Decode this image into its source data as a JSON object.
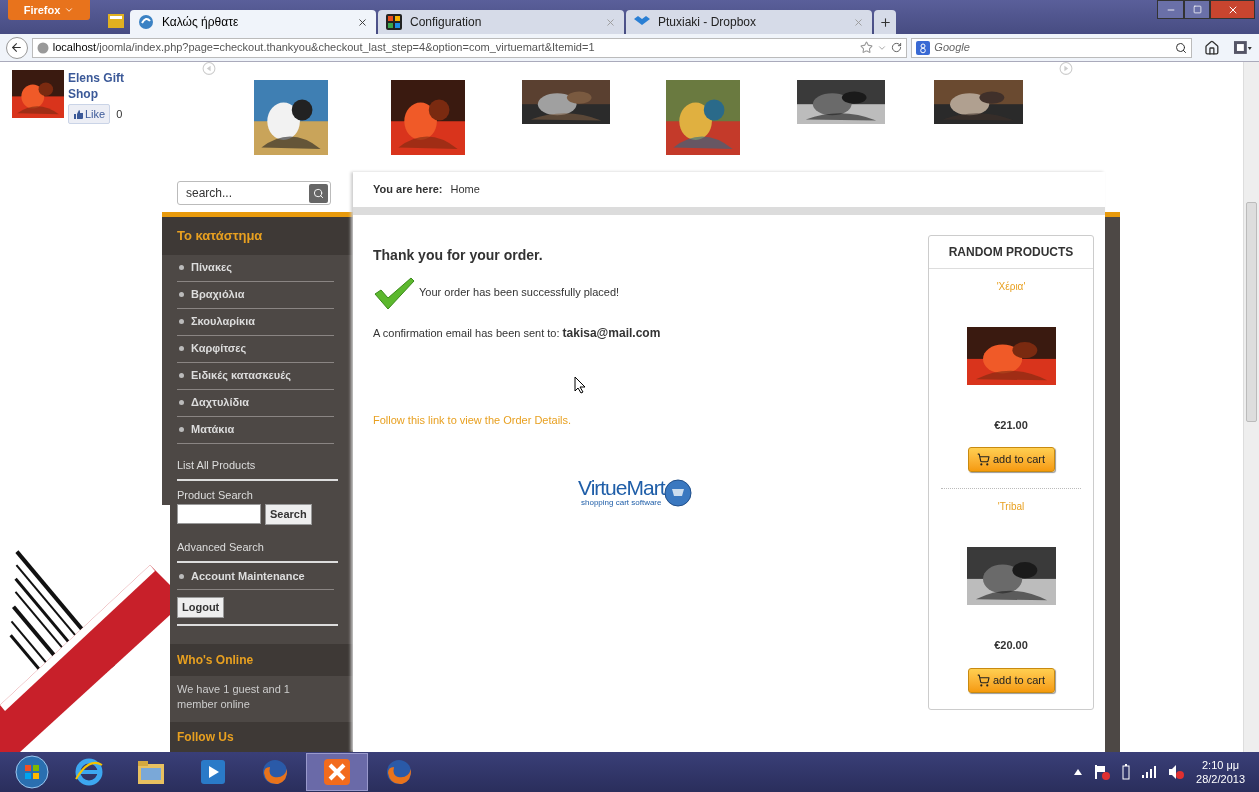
{
  "browser": {
    "menu_button": "Firefox",
    "tabs": [
      {
        "title": "Καλώς ήρθατε",
        "selected": true
      },
      {
        "title": "Configuration",
        "selected": false
      },
      {
        "title": "Ptuxiaki - Dropbox",
        "selected": false
      }
    ],
    "address": "**localhost**/joomla/index.php?page=checkout.thankyou&checkout_last_step=4&option=com_virtuemart&Itemid=1",
    "search_placeholder": "Google"
  },
  "facebook": {
    "page_name": "Elens Gift Shop",
    "like": "Like",
    "count": "0"
  },
  "site_search": {
    "placeholder": "search..."
  },
  "breadcrumb": {
    "label": "You are here:",
    "current": "Home"
  },
  "sidebar": {
    "title": "Το κατάστημα",
    "categories": [
      "Πίνακες",
      "Βραχιόλια",
      "Σκουλαρίκια",
      "Καρφίτσες",
      "Ειδικές κατασκευές",
      "Δαχτυλίδια",
      "Ματάκια"
    ],
    "list_all": "List All Products",
    "product_search_label": "Product Search",
    "search_button": "Search",
    "advanced_search": "Advanced Search",
    "account": "Account Maintenance",
    "logout": "Logout",
    "whos_online_title": "Who's Online",
    "whos_online_text": "We have 1 guest and 1 member online",
    "follow_title": "Follow Us"
  },
  "order": {
    "heading": "Thank you for your order.",
    "success": "Your order has been successfully placed!",
    "confirmation": "A confirmation email has been sent to: **takisa@mail.com**",
    "details_link": "Follow this link to view the Order Details.",
    "logo": "VirtueMart",
    "logo_tagline": "shopping cart software"
  },
  "random_products": {
    "title": "RANDOM PRODUCTS",
    "products": [
      {
        "name": "'Χέρια'",
        "price": "€21.00",
        "button": "add to cart"
      },
      {
        "name": "'Tribal",
        "price": "€20.00",
        "button": "add to cart"
      }
    ]
  },
  "taskbar": {
    "time": "2:10 μμ",
    "date": "28/2/2013"
  }
}
